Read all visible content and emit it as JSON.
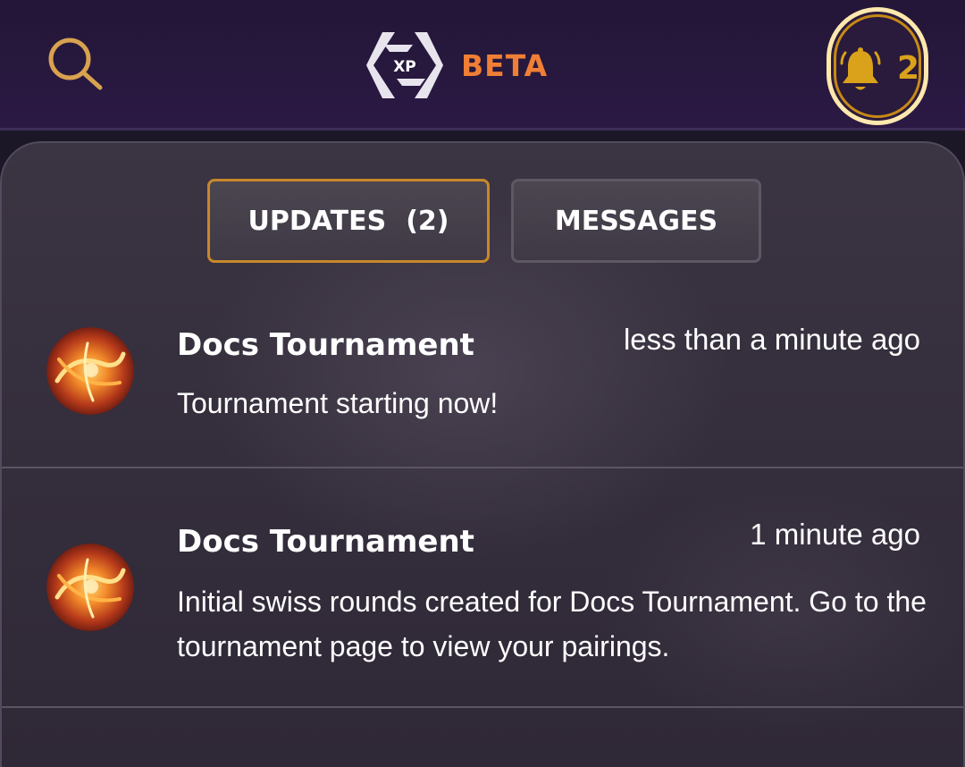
{
  "header": {
    "logo_text": "XP",
    "badge": "BETA",
    "notifications": {
      "count": "2",
      "icon": "bell-icon"
    },
    "search": {
      "icon": "search-icon"
    }
  },
  "tabs": {
    "updates": {
      "label": "UPDATES",
      "count": "(2)"
    },
    "messages": {
      "label": "MESSAGES"
    }
  },
  "notifications": [
    {
      "title": "Docs Tournament",
      "time": "less than a minute ago",
      "body": "Tournament starting now!",
      "avatar": "fire-avatar"
    },
    {
      "title": "Docs Tournament",
      "time": "1 minute ago",
      "body": "Initial swiss rounds created for Docs Tournament. Go to the tournament page to view your pairings.",
      "avatar": "fire-avatar"
    }
  ],
  "colors": {
    "accent": "#f07f35",
    "gold": "#d9a21a",
    "header_bg": "#261840",
    "panel_bg": "#38313f"
  }
}
